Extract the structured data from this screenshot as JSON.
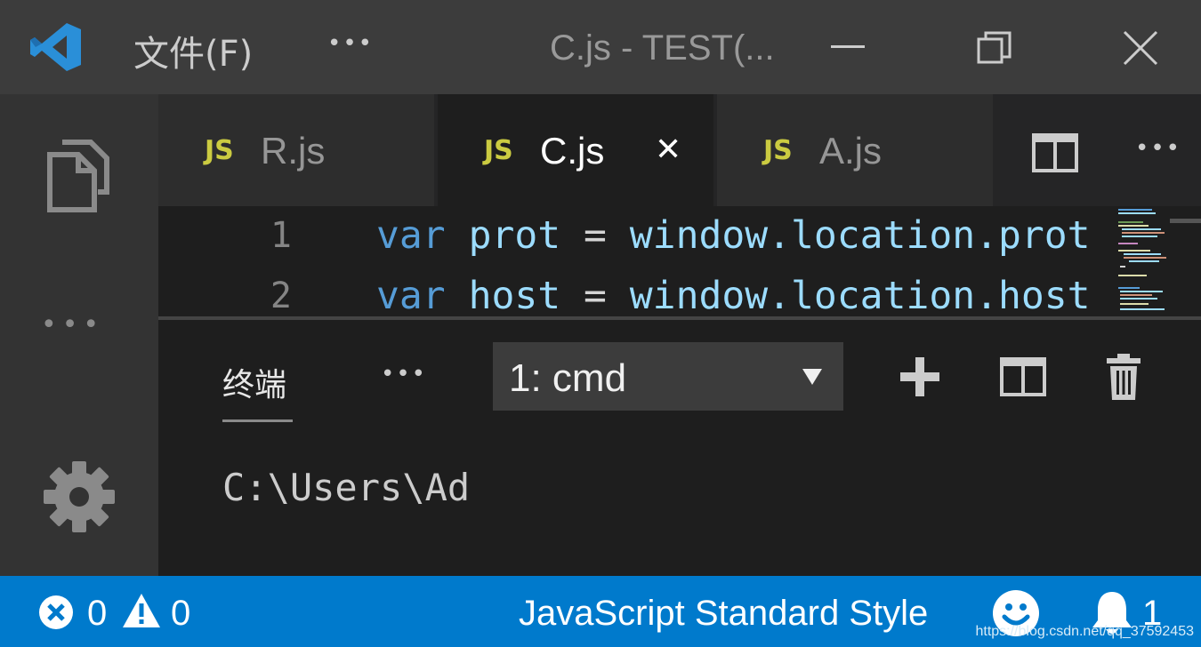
{
  "titlebar": {
    "menu_file": "文件(F)",
    "more": "•••",
    "title": "C.js - TEST(..."
  },
  "tabs": [
    {
      "badge": "JS",
      "label": "R.js",
      "active": false
    },
    {
      "badge": "JS",
      "label": "C.js",
      "active": true,
      "close": "✕"
    },
    {
      "badge": "JS",
      "label": "A.js",
      "active": false
    }
  ],
  "tabs_more": "•••",
  "editor": {
    "lines": [
      {
        "num": "1",
        "kw": "var",
        "name": "prot",
        "op": "=",
        "expr": "window.location.prot"
      },
      {
        "num": "2",
        "kw": "var",
        "name": "host",
        "op": "=",
        "expr": "window.location.host"
      }
    ]
  },
  "panel": {
    "tab_label": "终端",
    "more": "•••",
    "terminal_select": "1: cmd",
    "terminal_text": "C:\\Users\\Ad"
  },
  "activity_more": "•••",
  "statusbar": {
    "errors": "0",
    "warnings": "0",
    "formatter": "JavaScript Standard Style",
    "notifications": "1"
  },
  "watermark": "https://blog.csdn.net/qq_37592453",
  "colors": {
    "statusbar": "#007acc",
    "titlebar": "#3c3c3c",
    "activitybar": "#333333",
    "editor": "#1e1e1e",
    "js_badge": "#cbcb41",
    "keyword": "#569cd6",
    "variable": "#9cdcfe"
  }
}
